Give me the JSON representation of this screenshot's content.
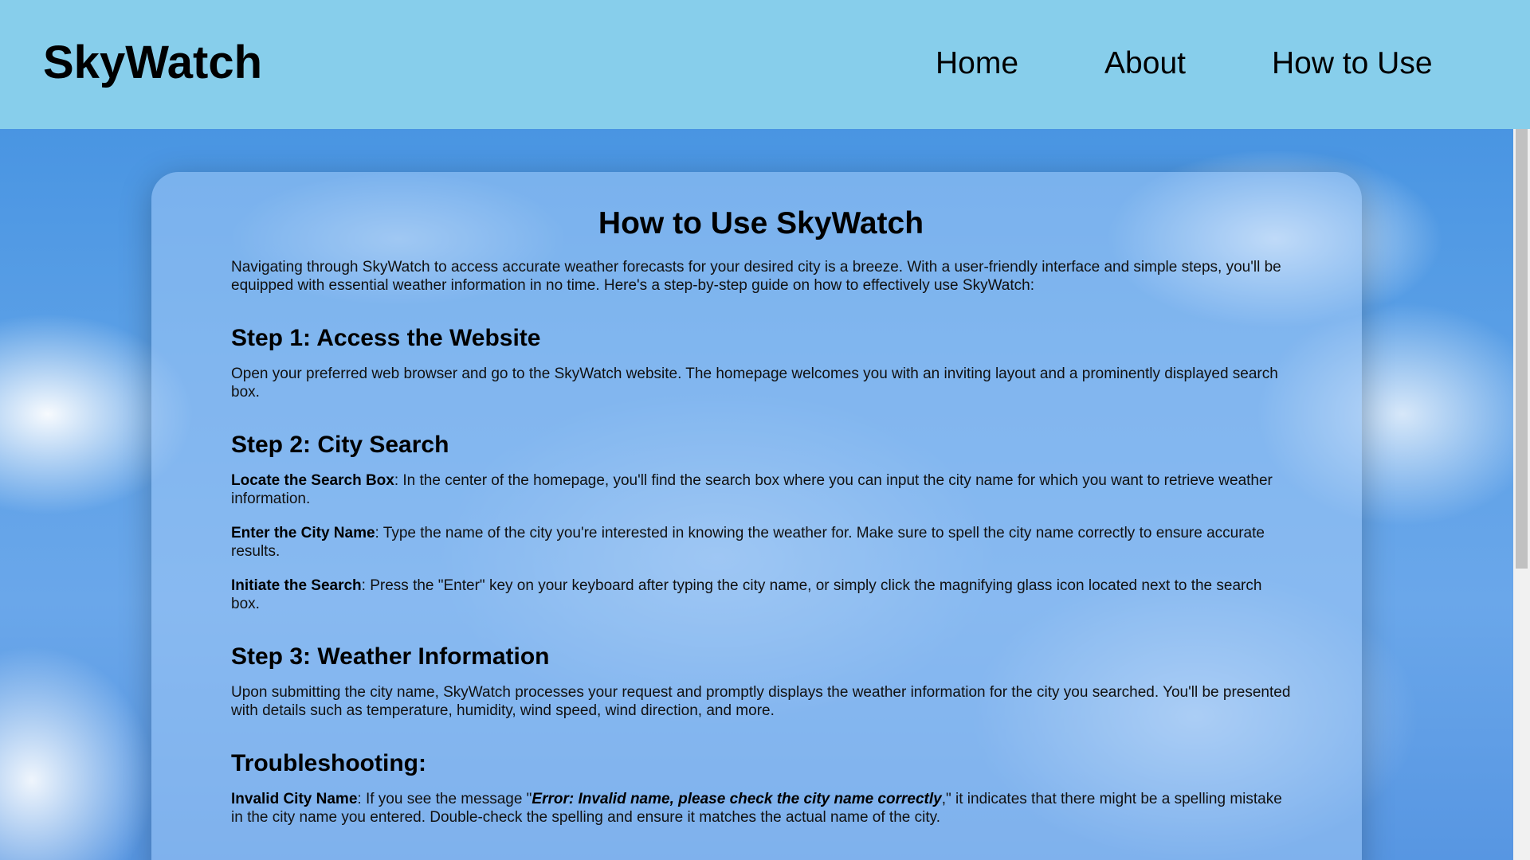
{
  "header": {
    "logo": "SkyWatch",
    "nav": {
      "home": "Home",
      "about": "About",
      "how_to_use": "How to Use"
    }
  },
  "colors": {
    "header_bg": "#87ceeb",
    "sky_blue": "#5a9fe6"
  },
  "content": {
    "title": "How to Use SkyWatch",
    "intro": "Navigating through SkyWatch to access accurate weather forecasts for your desired city is a breeze. With a user-friendly interface and simple steps, you'll be equipped with essential weather information in no time. Here's a step-by-step guide on how to effectively use SkyWatch:",
    "step1": {
      "heading": "Step 1: Access the Website",
      "text": "Open your preferred web browser and go to the SkyWatch website. The homepage welcomes you with an inviting layout and a prominently displayed search box."
    },
    "step2": {
      "heading": "Step 2: City Search",
      "items": [
        {
          "label": "Locate the Search Box",
          "text": ": In the center of the homepage, you'll find the search box where you can input the city name for which you want to retrieve weather information."
        },
        {
          "label": "Enter the City Name",
          "text": ": Type the name of the city you're interested in knowing the weather for. Make sure to spell the city name correctly to ensure accurate results."
        },
        {
          "label": "Initiate the Search",
          "text": ": Press the \"Enter\" key on your keyboard after typing the city name, or simply click the magnifying glass icon located next to the search box."
        }
      ]
    },
    "step3": {
      "heading": "Step 3: Weather Information",
      "text": "Upon submitting the city name, SkyWatch processes your request and promptly displays the weather information for the city you searched. You'll be presented with details such as temperature, humidity, wind speed, wind direction, and more."
    },
    "troubleshooting": {
      "heading": "Troubleshooting:",
      "label": "Invalid City Name",
      "text_before": ": If you see the message \"",
      "error_message": "Error: Invalid name, please check the city name correctly",
      "text_after": ",\" it indicates that there might be a spelling mistake in the city name you entered. Double-check the spelling and ensure it matches the actual name of the city."
    }
  }
}
